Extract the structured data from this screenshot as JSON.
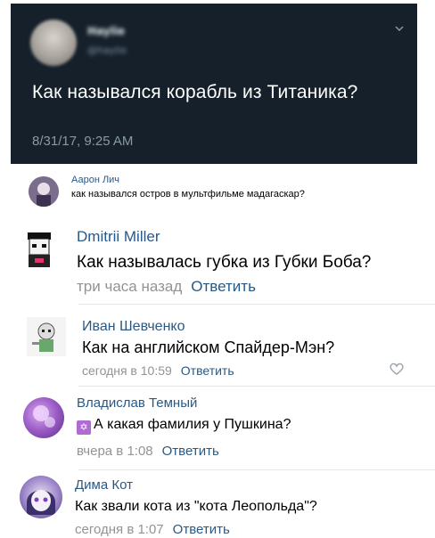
{
  "tweet": {
    "date": "8/31/17, 9:25 AM",
    "text": "Как назывался корабль из Титаника?",
    "author_name_blurred": "Haylie",
    "handle_blurred": "@haylie",
    "colors": {
      "background": "#15202b",
      "text": "#ffffff",
      "muted": "#8899a6"
    }
  },
  "comments": [
    {
      "author": "Аарон Лич",
      "text": "как назывался остров в мультфильме мадагаскар?"
    },
    {
      "author": "Dmitrii Miller",
      "text": "Как называлась губка из Губки Боба?",
      "time": "три часа назад",
      "reply_label": "Ответить"
    },
    {
      "author": "Иван Шевченко",
      "text": "Как на английском Спайдер-Мэн?",
      "time": "сегодня в 10:59",
      "reply_label": "Ответить"
    },
    {
      "author": "Владислав Темный",
      "text": "А какая фамилия у Пушкина?",
      "time": "вчера в 1:08",
      "reply_label": "Ответить",
      "emoji": "✡"
    },
    {
      "author": "Дима Кот",
      "text": "Как звали кота из \"кота Леопольда\"?",
      "time": "сегодня в 1:07",
      "reply_label": "Ответить"
    }
  ],
  "colors": {
    "link": "#2a5885",
    "meta": "#939393",
    "separator": "#e7e8ec"
  }
}
